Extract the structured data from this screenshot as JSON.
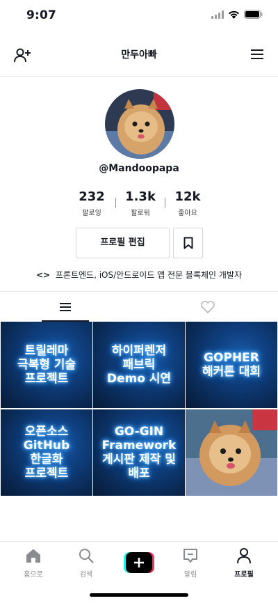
{
  "status": {
    "time": "9:07"
  },
  "header": {
    "title": "만두아빠"
  },
  "profile": {
    "username": "@Mandoopapa",
    "stats": [
      {
        "value": "232",
        "label": "팔로잉"
      },
      {
        "value": "1.3k",
        "label": "팔로워"
      },
      {
        "value": "12k",
        "label": "좋아요"
      }
    ],
    "edit_label": "프로필 편집",
    "bio": "프론트엔드, iOS/안드로이드 앱 전문 블록체인 개발자",
    "bio_icon": "<>"
  },
  "videos": [
    {
      "lines": [
        "트릴레마",
        "극복형 기술",
        "프로젝트"
      ]
    },
    {
      "lines": [
        "하이퍼렌저",
        "패브릭",
        "Demo 시연"
      ]
    },
    {
      "lines": [
        "GOPHER",
        "해커톤 대회"
      ]
    },
    {
      "lines": [
        "오픈소스",
        "GitHub",
        "한글화",
        "프로젝트"
      ]
    },
    {
      "lines": [
        "GO-GIN",
        "Framework",
        "게시판 제작 및",
        "배포"
      ]
    },
    {
      "type": "photo",
      "icon": "pomeranian-dog-photo"
    }
  ],
  "bottom_nav": {
    "home": "홈으로",
    "search": "검색",
    "inbox": "알림",
    "profile": "프로필"
  },
  "colors": {
    "accent_pink": "#fe2c55",
    "accent_cyan": "#25f4ee",
    "text": "#161823"
  }
}
